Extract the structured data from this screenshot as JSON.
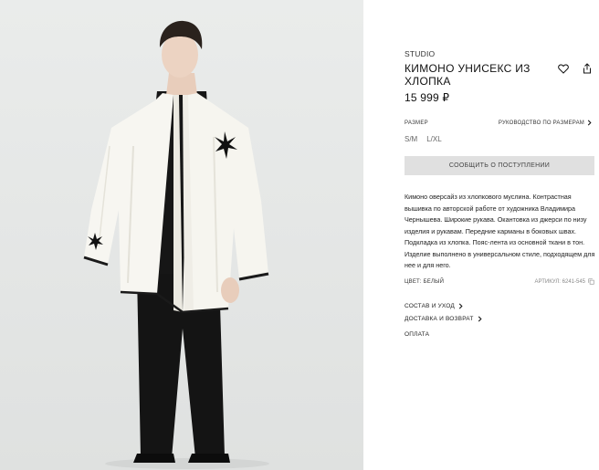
{
  "product": {
    "brand": "STUDIO",
    "title": "КИМОНО УНИСЕКС ИЗ ХЛОПКА",
    "price": "15 999 ₽",
    "size_label": "РАЗМЕР",
    "size_guide": "РУКОВОДСТВО ПО РАЗМЕРАМ",
    "sizes": [
      "S/M",
      "L/XL"
    ],
    "notify_label": "СООБЩИТЬ О ПОСТУПЛЕНИИ",
    "description": "Кимоно оверсайз из хлопкового муслина. Контрастная вышивка по авторской работе от художника Владимира Чернышева. Широкие рукава. Окантовка из джерси по низу изделия и рукавам. Передние карманы в боковых швах. Подкладка из хлопка. Пояс-лента из основной ткани в тон. Изделие выполнено в универсальном стиле, подходящем для нее и для него.",
    "color_label": "ЦВЕТ: БЕЛЫЙ",
    "article": "АРТИКУЛ: 6241-545"
  },
  "links": {
    "composition": "СОСТАВ И УХОД",
    "delivery": "ДОСТАВКА И ВОЗВРАТ",
    "payment": "ОПЛАТА"
  },
  "icons": {
    "favorite": "heart-icon",
    "share": "share-icon",
    "copy": "copy-icon",
    "chevron": "chevron-right-icon"
  },
  "colors": {
    "background": "#ffffff",
    "photo_background": "#e6e8e7",
    "button": "#e0e0e0",
    "kimono": "#f7f6f1",
    "dark": "#141414"
  }
}
